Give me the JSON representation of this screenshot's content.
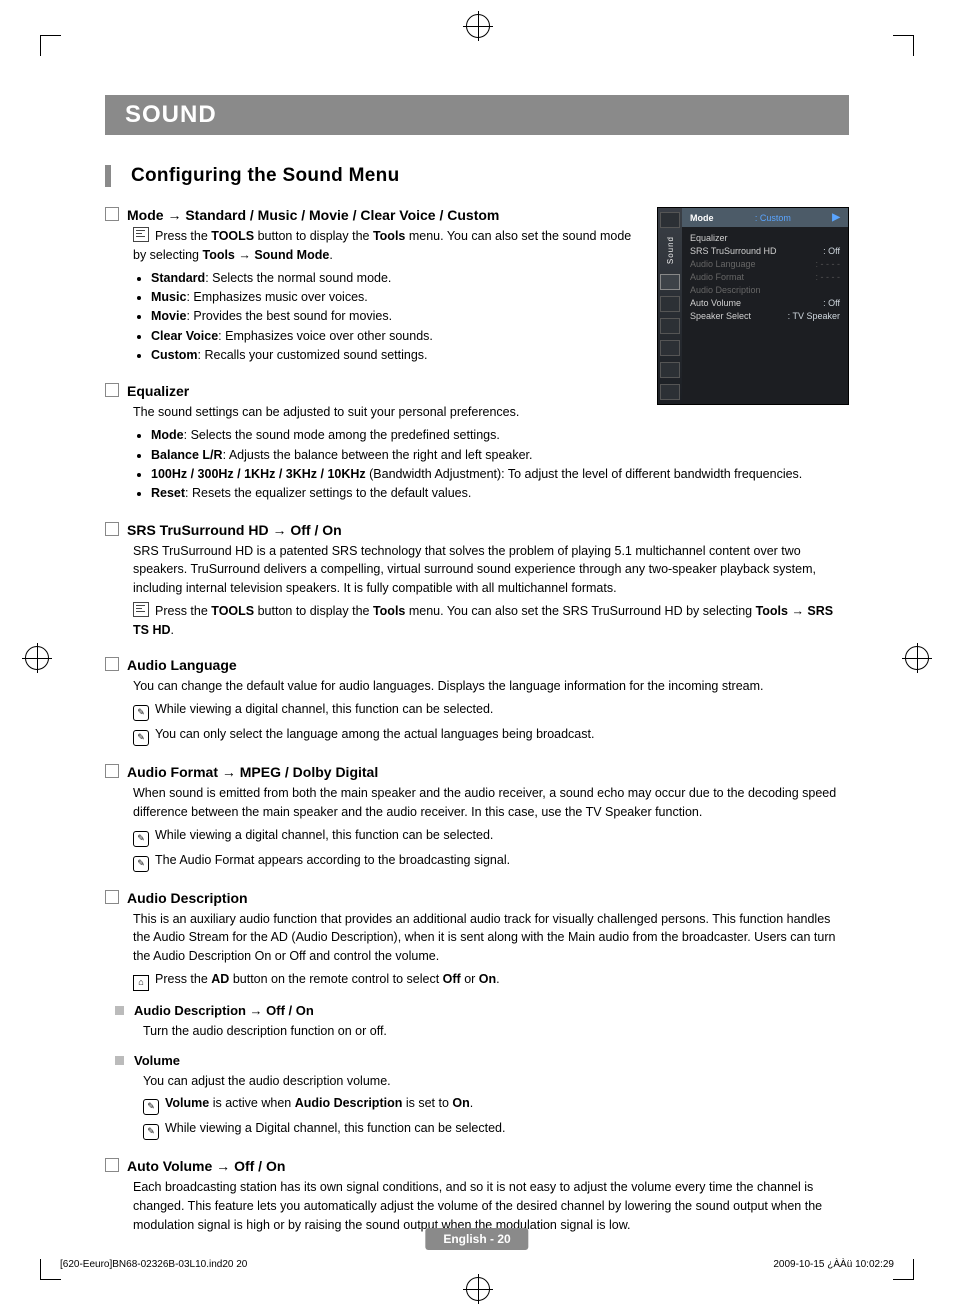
{
  "banner": "SOUND",
  "subhead": "Configuring the Sound Menu",
  "sections": {
    "mode": {
      "title": "Mode → Standard / Music / Movie / Clear Voice / Custom",
      "tool_line_before": "Press the ",
      "tool_bold1": "TOOLS",
      "tool_line_mid": " button to display the ",
      "tool_bold2": "Tools",
      "tool_line_after": " menu. You can also set the sound mode by selecting ",
      "tool_bold3": "Tools → Sound Mode",
      "bul1_b": "Standard",
      "bul1_t": ": Selects the normal sound mode.",
      "bul2_b": "Music",
      "bul2_t": ": Emphasizes music over voices.",
      "bul3_b": "Movie",
      "bul3_t": ": Provides the best sound for movies.",
      "bul4_b": "Clear Voice",
      "bul4_t": ": Emphasizes voice over other sounds.",
      "bul5_b": "Custom",
      "bul5_t": ": Recalls your customized sound settings."
    },
    "eq": {
      "title": "Equalizer",
      "intro": "The sound settings can be adjusted to suit your personal preferences.",
      "bul1_b": "Mode",
      "bul1_t": ": Selects the sound mode among the predefined settings.",
      "bul2_b": "Balance L/R",
      "bul2_t": ": Adjusts the balance between the right and left speaker.",
      "bul3_b": "100Hz / 300Hz / 1KHz / 3KHz / 10KHz",
      "bul3_t": " (Bandwidth Adjustment): To adjust the level of different bandwidth frequencies.",
      "bul4_b": "Reset",
      "bul4_t": ": Resets the equalizer settings to the default values."
    },
    "srs": {
      "title": "SRS TruSurround HD → Off / On",
      "para": "SRS TruSurround HD is a patented SRS technology that solves the problem of playing 5.1 multichannel content over two speakers. TruSurround delivers a compelling, virtual surround sound experience through any two-speaker playback system, including internal television speakers. It is fully compatible with all multichannel formats.",
      "tool_before": "Press the ",
      "tool_b1": "TOOLS",
      "tool_mid": " button to display the ",
      "tool_b2": "Tools",
      "tool_after": " menu. You can also set the SRS TruSurround HD by selecting ",
      "tool_b3": "Tools → SRS TS HD",
      "tool_end": "."
    },
    "lang": {
      "title": "Audio Language",
      "para": "You can change the default value for audio languages. Displays the language information for the incoming stream.",
      "note1": "While viewing a digital channel, this function can be selected.",
      "note2": "You can only select the language among the actual languages being broadcast."
    },
    "fmt": {
      "title": "Audio Format → MPEG / Dolby Digital",
      "para": "When sound is emitted from both the main speaker and the audio receiver, a sound echo may occur due to the decoding speed difference between the main speaker and the audio receiver. In this case, use the TV Speaker function.",
      "note1": "While viewing a digital channel, this function can be selected.",
      "note2": "The Audio Format appears according to the broadcasting signal."
    },
    "ad": {
      "title": "Audio Description",
      "para": "This is an auxiliary audio function that provides an additional audio track for visually challenged persons. This function handles the Audio Stream for the AD (Audio Description), when it is sent along with the Main audio from the broadcaster. Users can turn the Audio Description On or Off and control the volume.",
      "remote_before": "Press the ",
      "remote_b1": "AD",
      "remote_mid": " button on the remote control to select ",
      "remote_b2": "Off",
      "remote_or": " or ",
      "remote_b3": "On",
      "remote_end": ".",
      "sub1_title": "Audio Description → Off / On",
      "sub1_para": "Turn the audio description function on or off.",
      "sub2_title": "Volume",
      "sub2_para": "You can adjust the audio description volume.",
      "sub2_note1_b1": "Volume",
      "sub2_note1_mid": " is active when ",
      "sub2_note1_b2": "Audio Description",
      "sub2_note1_after": " is set to ",
      "sub2_note1_b3": "On",
      "sub2_note1_end": ".",
      "sub2_note2": "While viewing a Digital channel, this function can be selected."
    },
    "av": {
      "title": "Auto Volume → Off / On",
      "para": "Each broadcasting station has its own signal conditions, and so it is not easy to adjust the volume every time the channel is changed. This feature lets you automatically adjust the volume of the desired channel by lowering the sound output when the modulation signal is high or by raising the sound output when the modulation signal is low."
    }
  },
  "osd": {
    "tab_label": "Sound",
    "header_label": "Mode",
    "header_value": ": Custom",
    "arrow": "▶",
    "rows": [
      {
        "label": "Equalizer",
        "value": "",
        "dim": false
      },
      {
        "label": "SRS TruSurround HD",
        "value": ": Off",
        "dim": false
      },
      {
        "label": "Audio Language",
        "value": ": - - - -",
        "dim": true
      },
      {
        "label": "Audio Format",
        "value": ": - - - -",
        "dim": true
      },
      {
        "label": "Audio Description",
        "value": "",
        "dim": true
      },
      {
        "label": "Auto Volume",
        "value": ": Off",
        "dim": false
      },
      {
        "label": "Speaker Select",
        "value": ": TV Speaker",
        "dim": false
      }
    ]
  },
  "page_label": "English - 20",
  "footer_left": "[620-Eeuro]BN68-02326B-03L10.ind20   20",
  "footer_right": "2009-10-15   ¿ÀÀü 10:02:29",
  "note_glyph": "✎",
  "remote_glyph": "⌂"
}
